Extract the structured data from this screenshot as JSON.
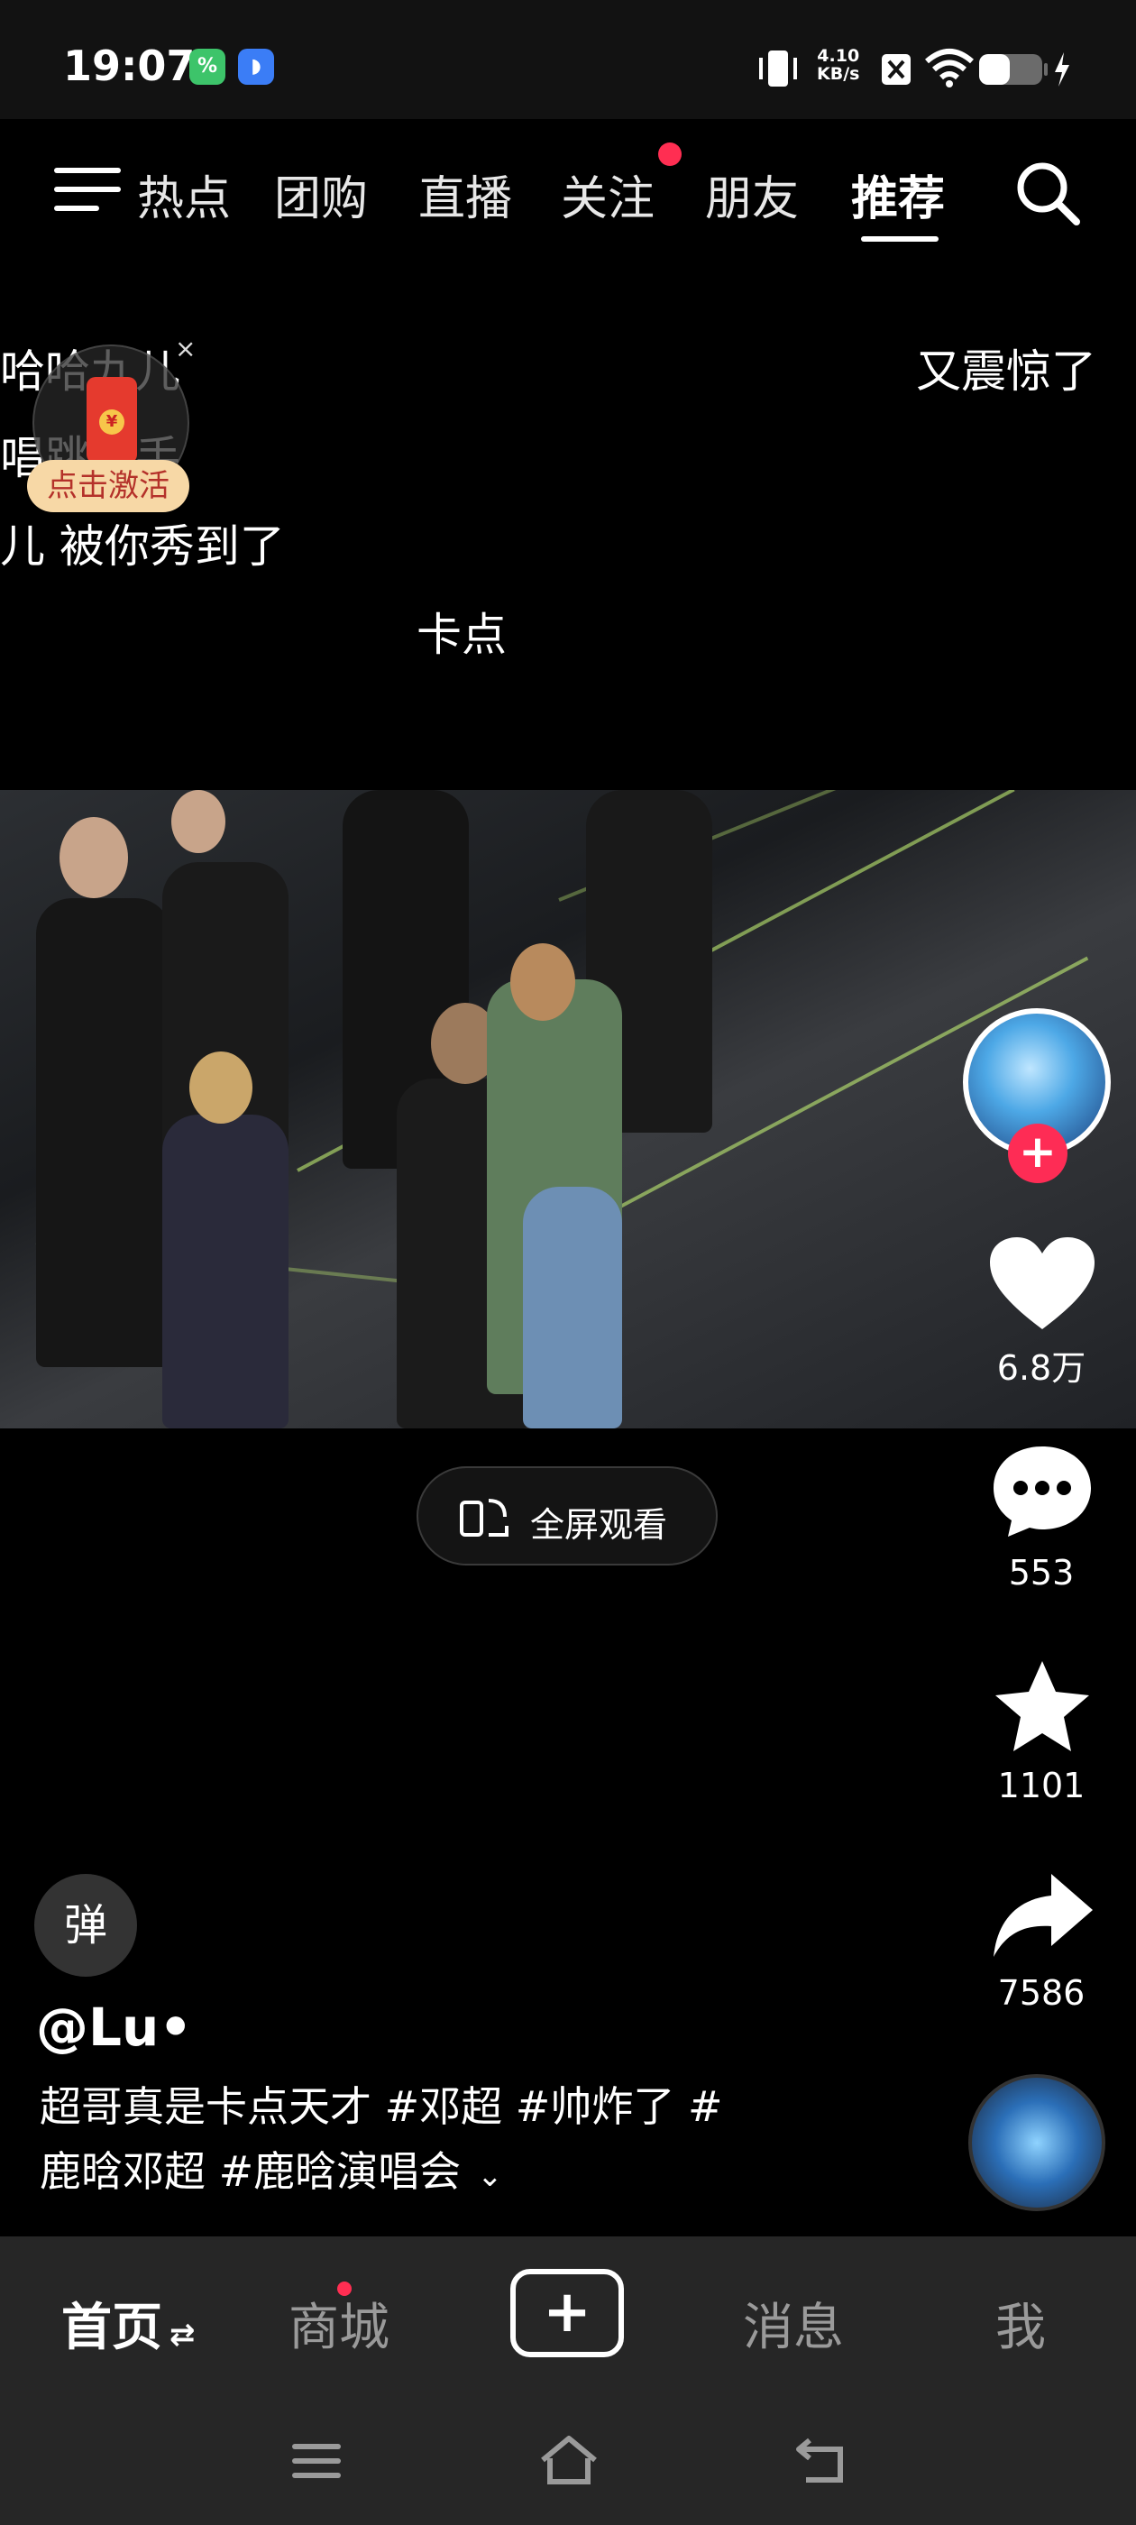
{
  "status_bar": {
    "time": "19:07",
    "app_badges": [
      "%",
      "◗"
    ],
    "net_speed_value": "4.10",
    "net_speed_unit": "KB/s",
    "icons": [
      "vibrate-icon",
      "sim-off-icon",
      "wifi-icon",
      "battery-icon",
      "charging-icon"
    ]
  },
  "top_nav": {
    "tabs": [
      {
        "label": "热点"
      },
      {
        "label": "团购"
      },
      {
        "label": "直播"
      },
      {
        "label": "关注"
      },
      {
        "label": "朋友"
      },
      {
        "label": "推荐"
      }
    ],
    "active_tab": "推荐",
    "notify_dot_color": "#ff2e52"
  },
  "overlay_texts": {
    "line1": "哈哈九儿",
    "line2": "唱跳歌手",
    "line3": "儿 被你秀到了",
    "line4": "卡点",
    "right_text": "又震惊了"
  },
  "red_packet": {
    "label": "点击激活",
    "close": "×",
    "coin": "¥"
  },
  "video": {
    "fullscreen_label": "全屏观看"
  },
  "right_rail": {
    "follow_plus": "+",
    "likes": "6.8万",
    "comments": "553",
    "favorites": "1101",
    "shares": "7586"
  },
  "danmaku_toggle": "弹",
  "post": {
    "author": "@Lu•",
    "caption_line1": "超哥真是卡点天才 #邓超 #帅炸了 #",
    "caption_line2": "鹿晗邓超 #鹿晗演唱会",
    "expand_icon": "⌄"
  },
  "bottom_nav": {
    "home": "首页",
    "home_switch": "⇄",
    "mall": "商城",
    "add": "+",
    "messages": "消息",
    "me": "我"
  },
  "colors": {
    "accent": "#fe2c55",
    "nav_bg": "#262626"
  }
}
